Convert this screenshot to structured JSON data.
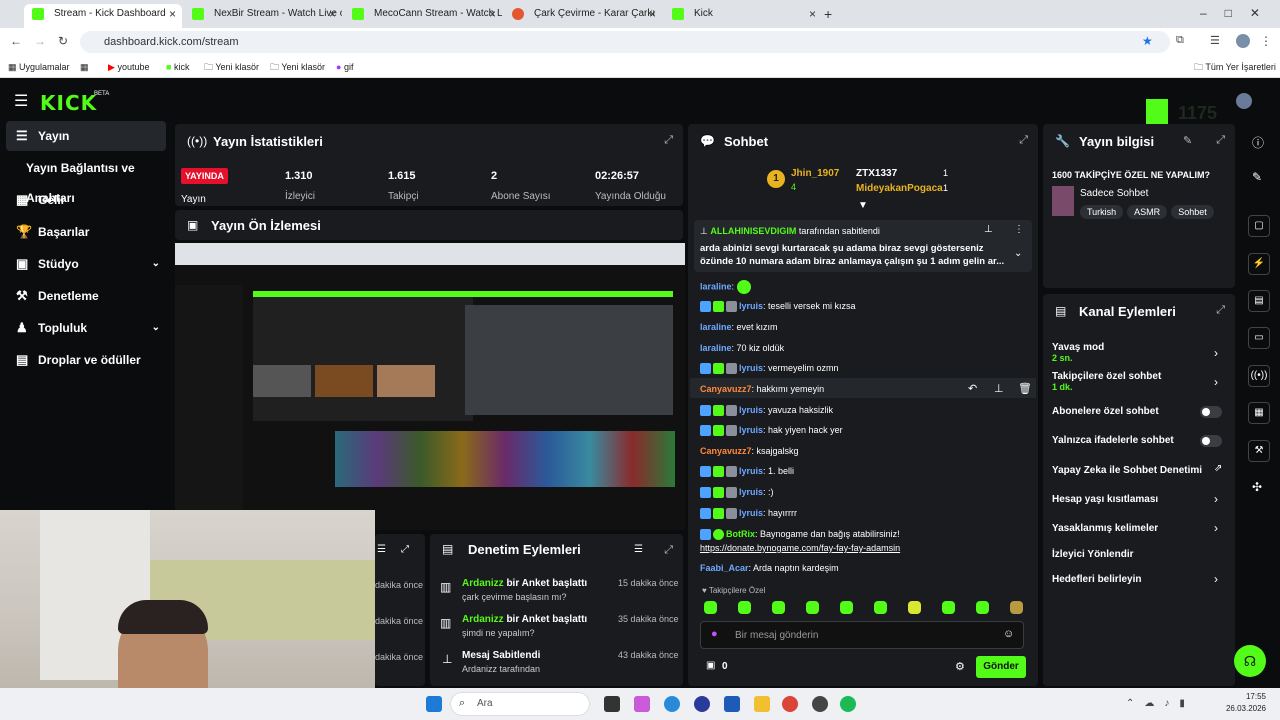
{
  "browser": {
    "tabs": [
      {
        "label": "Stream - Kick Dashboard",
        "active": true
      },
      {
        "label": "NexBir Stream - Watch Live on",
        "active": false
      },
      {
        "label": "MecoCann Stream - Watch Live",
        "active": false
      },
      {
        "label": "Çark Çevirme - Karar Çarkı",
        "active": false
      },
      {
        "label": "Kick",
        "active": false
      }
    ],
    "new_tab": "+",
    "url": "dashboard.kick.com/stream",
    "bookmarks": [
      "Uygulamalar",
      "youtube",
      "kick",
      "Yeni klasör",
      "Yeni klasör",
      "gif"
    ],
    "all_bookmarks": "Tüm Yer İşaretleri"
  },
  "kick": {
    "logo": "KICK",
    "logo_beta": "BETA",
    "sidebar": {
      "items": [
        {
          "label": "Yayın",
          "icon": "☰",
          "active": true
        },
        {
          "label": "Yayın Bağlantısı ve Anahtarı",
          "icon": "",
          "active": false
        },
        {
          "label": "Gelir",
          "icon": "▦",
          "active": false
        },
        {
          "label": "Başarılar",
          "icon": "🏆",
          "active": false
        },
        {
          "label": "Stüdyo",
          "icon": "▣",
          "active": false,
          "expand": true
        },
        {
          "label": "Denetleme",
          "icon": "⚒",
          "active": false
        },
        {
          "label": "Topluluk",
          "icon": "♟",
          "active": false,
          "expand": true
        },
        {
          "label": "Droplar ve ödüller",
          "icon": "▤",
          "active": false
        }
      ]
    },
    "stats": {
      "title": "Yayın İstatistikleri",
      "live_badge": "YAYINDA",
      "live_label": "Yayın",
      "items": [
        {
          "value": "1.310",
          "label": "İzleyici"
        },
        {
          "value": "1.615",
          "label": "Takipçi"
        },
        {
          "value": "2",
          "label": "Abone Sayısı"
        },
        {
          "value": "02:26:57",
          "label": "Yayında Olduğu"
        }
      ]
    },
    "preview": {
      "title": "Yayın Ön İzlemesi"
    },
    "audit": {
      "title": "Denetim Eylemleri",
      "left_times": [
        "dakika önce",
        "dakika önce",
        "dakika önce"
      ],
      "rows": [
        {
          "user": "Ardanizz",
          "action": "bir Anket başlattı",
          "detail": "çark çevirme başlasın mı?",
          "time": "15 dakika önce"
        },
        {
          "user": "Ardanizz",
          "action": "bir Anket başlattı",
          "detail": "şimdi ne yapalım?",
          "time": "35 dakika önce"
        },
        {
          "user": "Mesaj Sabitlendi",
          "action": "",
          "detail": "Ardanizz tarafından",
          "time": "43 dakika önce"
        }
      ]
    },
    "chat": {
      "title": "Sohbet",
      "leaderboard": [
        {
          "rank": "1",
          "name": "Jhin_1907",
          "count": "4"
        },
        {
          "name": "ZTX1337",
          "count": "1"
        },
        {
          "name": "MideyakanPogaca",
          "count": "1"
        }
      ],
      "pinned": {
        "by": "ALLAHINISEVDIGIM",
        "by_suffix": "tarafından sabitlendi",
        "text": "arda abinizi sevgi kurtaracak şu adama biraz sevgi gösterseniz özünde 10 numara adam biraz anlamaya çalışın şu 1 adım gelin ar..."
      },
      "messages": [
        {
          "user": "laraline",
          "text": "",
          "color": "green"
        },
        {
          "user": "lyruis",
          "text": "teselli versek mi kızsa",
          "color": "blue"
        },
        {
          "user": "laraline",
          "text": "evet kızım",
          "color": "green"
        },
        {
          "user": "laraline",
          "text": "70 kiz oldük",
          "color": "green"
        },
        {
          "user": "lyruis",
          "text": "vermeyelim ozmn",
          "color": "blue"
        },
        {
          "user": "Canyavuzz7",
          "text": "hakkımı yemeyin",
          "color": "orange"
        },
        {
          "user": "lyruis",
          "text": "yavuza haksizlik",
          "color": "blue"
        },
        {
          "user": "lyruis",
          "text": "hak yiyen hack yer",
          "color": "blue"
        },
        {
          "user": "Canyavuzz7",
          "text": "ksajgalskg",
          "color": "orange"
        },
        {
          "user": "lyruis",
          "text": "1. belli",
          "color": "blue"
        },
        {
          "user": "lyruis",
          "text": ":)",
          "color": "blue"
        },
        {
          "user": "lyruis",
          "text": "hayırrrr",
          "color": "blue"
        },
        {
          "user": "BotRix",
          "text": "Baynogame dan bağış atabilirsiniz!",
          "color": "green"
        },
        {
          "user": "",
          "text": "https://donate.bynogame.com/fay-fay-fay-adamsin",
          "color": "link"
        },
        {
          "user": "Faabi_Acar",
          "text": "Arda naptın kardeşim",
          "color": "green"
        }
      ],
      "emote_label": "Takipçilere Özel",
      "input_placeholder": "Bir mesaj gönderin",
      "points": "0",
      "send": "Gönder"
    },
    "info": {
      "title": "Yayın bilgisi",
      "stream_title": "1600 TAKİPÇİYE ÖZEL NE YAPALIM?",
      "category": "Sadece Sohbet",
      "tags": [
        "Turkish",
        "ASMR",
        "Sohbet"
      ]
    },
    "channel_actions": {
      "title": "Kanal Eylemleri",
      "items": [
        {
          "label": "Yavaş mod",
          "sub": "2 sn.",
          "control": "chevron"
        },
        {
          "label": "Takipçilere özel sohbet",
          "sub": "1 dk.",
          "control": "chevron"
        },
        {
          "label": "Abonelere özel sohbet",
          "sub": "",
          "control": "toggle"
        },
        {
          "label": "Yalnızca ifadelerle sohbet",
          "sub": "",
          "control": "toggle"
        },
        {
          "label": "Yapay Zeka ile Sohbet Denetimi",
          "sub": "",
          "control": "external"
        },
        {
          "label": "Hesap yaşı kısıtlaması",
          "sub": "",
          "control": "chevron"
        },
        {
          "label": "Yasaklanmış kelimeler",
          "sub": "",
          "control": "chevron"
        },
        {
          "label": "İzleyici Yönlendir",
          "sub": "",
          "control": "none"
        },
        {
          "label": "Hedefleri belirleyin",
          "sub": "",
          "control": "chevron"
        }
      ]
    },
    "overlay_number": "1175"
  },
  "taskbar": {
    "search": "Ara",
    "time": "17:55",
    "date": "26.03.2026"
  },
  "colors": {
    "accent": "#53fc18",
    "panel": "#191b1f",
    "bg": "#0b0c0d"
  }
}
